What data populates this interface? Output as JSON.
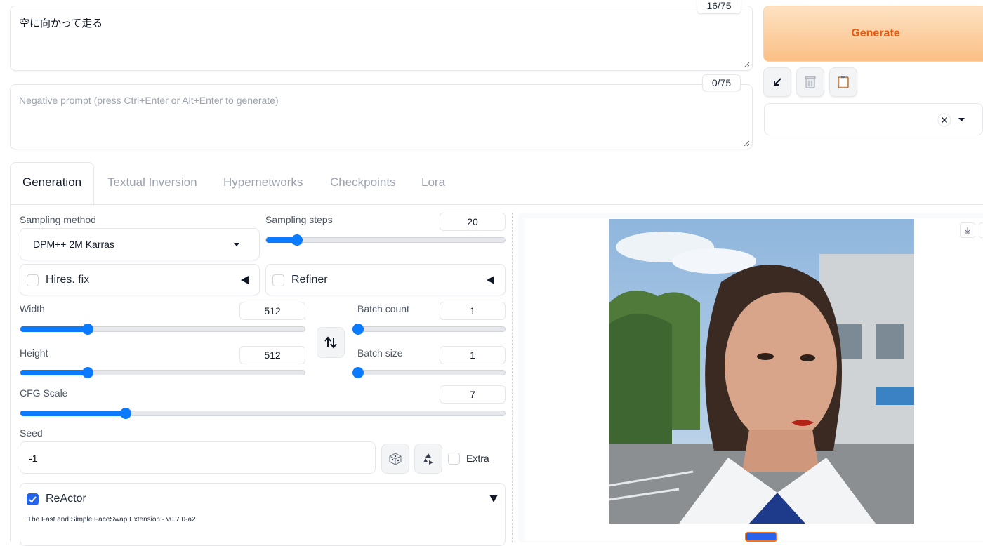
{
  "prompt": {
    "text": "空に向かって走る",
    "counter": "16/75"
  },
  "negative_prompt": {
    "placeholder": "Negative prompt (press Ctrl+Enter or Alt+Enter to generate)",
    "counter": "0/75"
  },
  "generate": {
    "label": "Generate"
  },
  "tools": {
    "icons": [
      "arrow-down-left-icon",
      "trash-icon",
      "clipboard-icon"
    ]
  },
  "tabs": [
    {
      "label": "Generation",
      "active": true
    },
    {
      "label": "Textual Inversion"
    },
    {
      "label": "Hypernetworks"
    },
    {
      "label": "Checkpoints"
    },
    {
      "label": "Lora"
    }
  ],
  "sampling": {
    "method_label": "Sampling method",
    "method_value": "DPM++ 2M Karras",
    "steps_label": "Sampling steps",
    "steps_value": "20",
    "steps_fraction": 0.13
  },
  "hires": {
    "label": "Hires. fix"
  },
  "refiner": {
    "label": "Refiner"
  },
  "width": {
    "label": "Width",
    "value": "512",
    "fraction": 0.237
  },
  "height": {
    "label": "Height",
    "value": "512",
    "fraction": 0.237
  },
  "batch_count": {
    "label": "Batch count",
    "value": "1",
    "fraction": 0.0
  },
  "batch_size": {
    "label": "Batch size",
    "value": "1",
    "fraction": 0.0
  },
  "cfg": {
    "label": "CFG Scale",
    "value": "7",
    "fraction": 0.217
  },
  "seed": {
    "label": "Seed",
    "value": "-1",
    "extra_label": "Extra"
  },
  "reactor": {
    "label": "ReActor",
    "subtitle": "The Fast and Simple FaceSwap Extension - v0.7.0-a2"
  },
  "colors": {
    "accent": "#0a7bff",
    "generate_text": "#ea580c"
  }
}
